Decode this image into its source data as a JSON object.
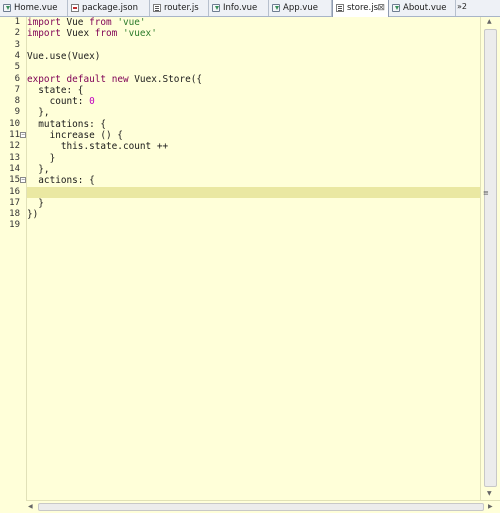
{
  "tabs": [
    {
      "label": "Home.vue",
      "icon": "vue-file-icon"
    },
    {
      "label": "package.json",
      "icon": "json-file-icon"
    },
    {
      "label": "router.js",
      "icon": "js-file-icon"
    },
    {
      "label": "Info.vue",
      "icon": "vue-file-icon"
    },
    {
      "label": "App.vue",
      "icon": "vue-file-icon"
    },
    {
      "label": "store.js",
      "icon": "js-file-icon",
      "active": true,
      "close": "⊠"
    },
    {
      "label": "About.vue",
      "icon": "vue-file-icon"
    }
  ],
  "overflow": {
    "label": "»2"
  },
  "editor": {
    "current_line": 16,
    "line_numbers": [
      "1",
      "2",
      "3",
      "4",
      "5",
      "6",
      "7",
      "8",
      "9",
      "10",
      "11",
      "12",
      "13",
      "14",
      "15",
      "16",
      "17",
      "18",
      "19"
    ],
    "fold_markers": [
      {
        "line": "11",
        "symbol": "−"
      },
      {
        "line": "15",
        "symbol": "−"
      }
    ],
    "lines": [
      "import Vue from 'vue'",
      "import Vuex from 'vuex'",
      "",
      "Vue.use(Vuex)",
      "",
      "export default new Vuex.Store({",
      "  state: {",
      "    count: 0",
      "  },",
      "  mutations: {",
      "    increase () {",
      "      this.state.count ++",
      "    }",
      "  },",
      "  actions: {",
      "",
      "  }",
      "})",
      ""
    ]
  },
  "colors": {
    "editor_bg": "#ffffd9",
    "current_line": "#eae8a2",
    "keyword": "#7f0055",
    "string": "#2a7a2a",
    "number": "#c000c0"
  }
}
